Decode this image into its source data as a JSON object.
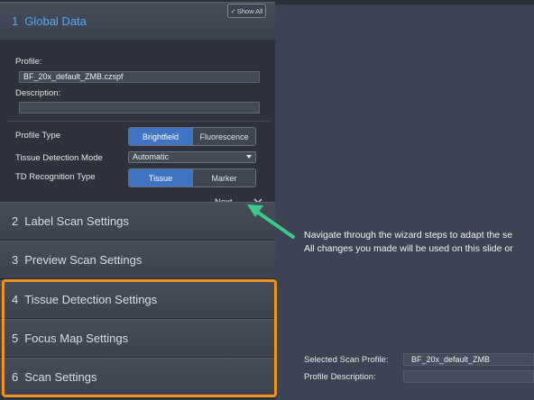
{
  "wizard": {
    "show_all_label": "Show All",
    "active_step": {
      "number": "1",
      "title": "Global Data"
    },
    "steps": [
      {
        "number": "2",
        "title": "Label Scan Settings"
      },
      {
        "number": "3",
        "title": "Preview Scan Settings"
      },
      {
        "number": "4",
        "title": "Tissue Detection Settings"
      },
      {
        "number": "5",
        "title": "Focus Map Settings"
      },
      {
        "number": "6",
        "title": "Scan Settings"
      }
    ],
    "next_label": "Next"
  },
  "global_data": {
    "profile_label": "Profile:",
    "profile_value": "BF_20x_default_ZMB.czspf",
    "description_label": "Description:",
    "description_value": "",
    "profile_type_label": "Profile Type",
    "profile_type_options": [
      "Brightfield",
      "Fluorescence"
    ],
    "profile_type_selected": "Brightfield",
    "tissue_detection_mode_label": "Tissue Detection Mode",
    "tissue_detection_mode_value": "Automatic",
    "td_recognition_type_label": "TD Recognition Type",
    "td_recognition_options": [
      "Tissue",
      "Marker"
    ],
    "td_recognition_selected": "Tissue"
  },
  "callout": {
    "line1": "Navigate through the wizard steps to adapt the se",
    "line2": "All changes you made will be used on this slide or",
    "arrow_color": "#3ec98a",
    "highlight_color": "#f1921e"
  },
  "summary": {
    "selected_scan_profile_label": "Selected Scan Profile:",
    "selected_scan_profile_value": "BF_20x_default_ZMB",
    "profile_description_label": "Profile Description:",
    "profile_description_value": ""
  }
}
